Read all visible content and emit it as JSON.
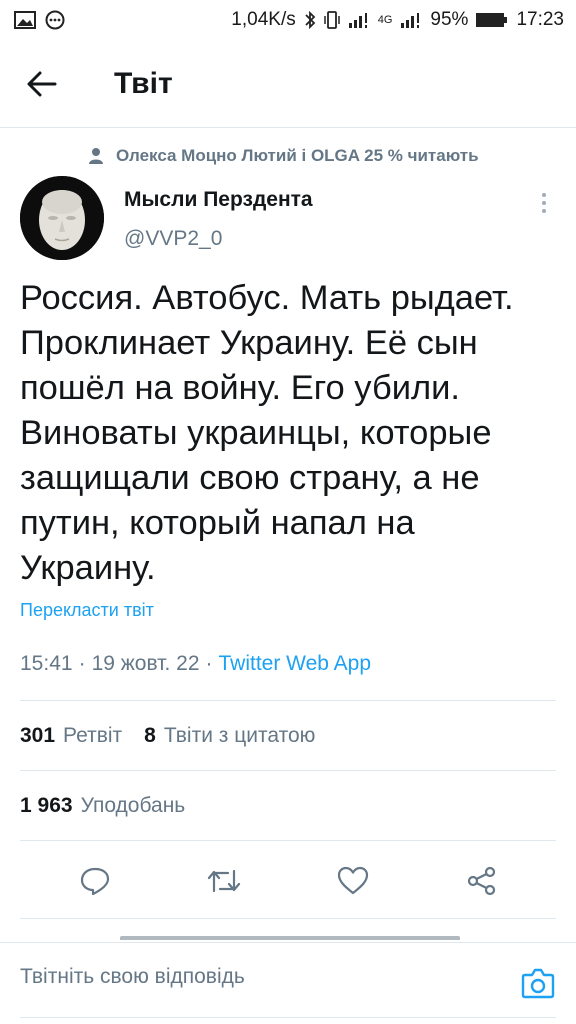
{
  "status_bar": {
    "network_speed": "1,04K/s",
    "network_type": "4G",
    "battery": "95%",
    "time": "17:23",
    "icons": [
      "gallery-icon",
      "chat-icon",
      "bluetooth-icon",
      "vibrate-icon",
      "signal-icon",
      "battery-icon"
    ]
  },
  "header": {
    "title": "Твіт",
    "back_icon": "arrow-left-icon"
  },
  "social_context": {
    "icon": "person-icon",
    "text": "Олекса Моцно Лютий і OLGA 25 % читають"
  },
  "tweet": {
    "author_name": "Мысли Перздента",
    "author_handle": "@VVP2_0",
    "text": "Россия. Автобус. Мать рыдает.\nПроклинает Украину. Её сын\nпошёл на войну. Его убили.\nВиноваты украинцы, которые\nзащищали свою страну, а не\nпутин, который напал на\nУкраину.",
    "translate_label": "Перекласти твіт",
    "time": "15:41",
    "date": "19 жовт. 22",
    "separator": "·",
    "source_app": "Twitter Web App"
  },
  "stats": {
    "retweets_count": "301",
    "retweets_label": "Ретвіт",
    "quotes_count": "8",
    "quotes_label": "Твіти з цитатою",
    "likes_count": "1 963",
    "likes_label": "Уподобань"
  },
  "actions": [
    "reply-icon",
    "retweet-icon",
    "like-icon",
    "share-icon"
  ],
  "reply": {
    "placeholder": "Твітніть свою відповідь",
    "camera_icon": "camera-icon"
  },
  "colors": {
    "accent": "#1da1f2",
    "text": "#14171a",
    "secondary": "#657786",
    "divider": "#e1e8ed"
  }
}
